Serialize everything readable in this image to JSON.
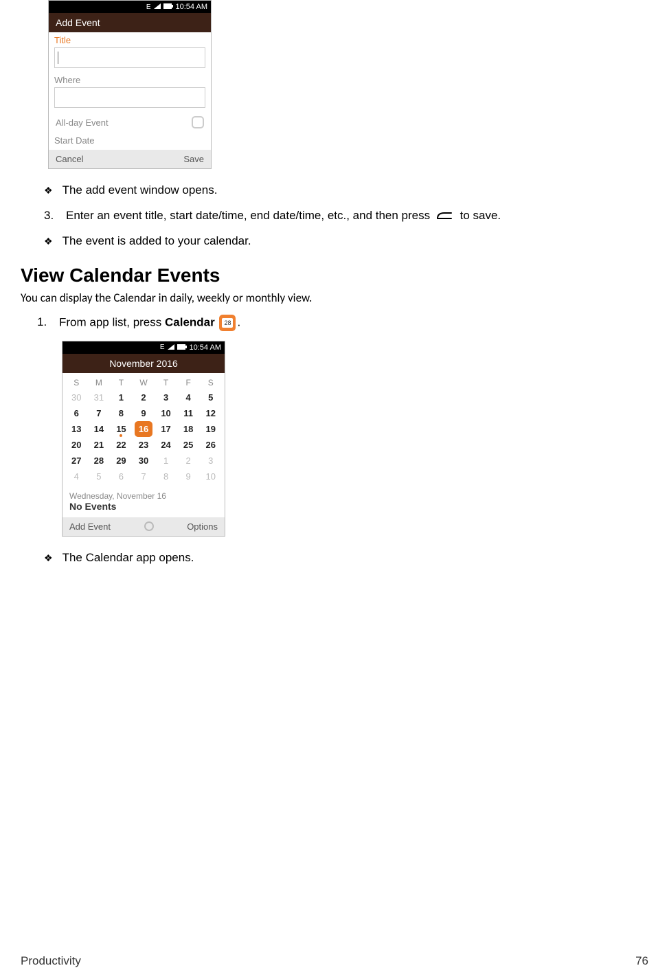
{
  "phone1": {
    "status": {
      "net": "E",
      "time": "10:54 AM"
    },
    "header": "Add Event",
    "titleLabel": "Title",
    "titleValue": "",
    "whereLabel": "Where",
    "whereValue": "",
    "allDayLabel": "All-day Event",
    "startDateLabel": "Start Date",
    "cancel": "Cancel",
    "save": "Save"
  },
  "bullets": {
    "b1": "The add event window opens.",
    "b3": "The event is added to your calendar.",
    "b5": "The Calendar app opens."
  },
  "step3": {
    "num": "3.",
    "textA": "Enter an event title, start date/time, end date/time, etc., and then press ",
    "textB": " to save."
  },
  "heading": "View Calendar Events",
  "lead": "You can display the Calendar in daily, weekly or monthly view.",
  "step1": {
    "num": "1.",
    "textA": "From app list, press ",
    "bold": "Calendar",
    "iconDay": "28",
    "textB": "."
  },
  "phone2": {
    "status": {
      "net": "E",
      "time": "10:54 AM"
    },
    "header": "November 2016",
    "dow": [
      "S",
      "M",
      "T",
      "W",
      "T",
      "F",
      "S"
    ],
    "weeks": [
      [
        {
          "n": "30",
          "dim": true
        },
        {
          "n": "31",
          "dim": true
        },
        {
          "n": "1"
        },
        {
          "n": "2"
        },
        {
          "n": "3"
        },
        {
          "n": "4"
        },
        {
          "n": "5"
        }
      ],
      [
        {
          "n": "6"
        },
        {
          "n": "7"
        },
        {
          "n": "8"
        },
        {
          "n": "9"
        },
        {
          "n": "10"
        },
        {
          "n": "11"
        },
        {
          "n": "12"
        }
      ],
      [
        {
          "n": "13"
        },
        {
          "n": "14"
        },
        {
          "n": "15",
          "dot": true
        },
        {
          "n": "16",
          "sel": true
        },
        {
          "n": "17"
        },
        {
          "n": "18"
        },
        {
          "n": "19"
        }
      ],
      [
        {
          "n": "20"
        },
        {
          "n": "21"
        },
        {
          "n": "22"
        },
        {
          "n": "23"
        },
        {
          "n": "24"
        },
        {
          "n": "25"
        },
        {
          "n": "26"
        }
      ],
      [
        {
          "n": "27"
        },
        {
          "n": "28"
        },
        {
          "n": "29"
        },
        {
          "n": "30"
        },
        {
          "n": "1",
          "dim": true
        },
        {
          "n": "2",
          "dim": true
        },
        {
          "n": "3",
          "dim": true
        }
      ],
      [
        {
          "n": "4",
          "dim": true
        },
        {
          "n": "5",
          "dim": true
        },
        {
          "n": "6",
          "dim": true
        },
        {
          "n": "7",
          "dim": true
        },
        {
          "n": "8",
          "dim": true
        },
        {
          "n": "9",
          "dim": true
        },
        {
          "n": "10",
          "dim": true
        }
      ]
    ],
    "eventDate": "Wednesday, November 16",
    "eventNone": "No Events",
    "addEvent": "Add Event",
    "options": "Options"
  },
  "footer": {
    "section": "Productivity",
    "page": "76"
  }
}
